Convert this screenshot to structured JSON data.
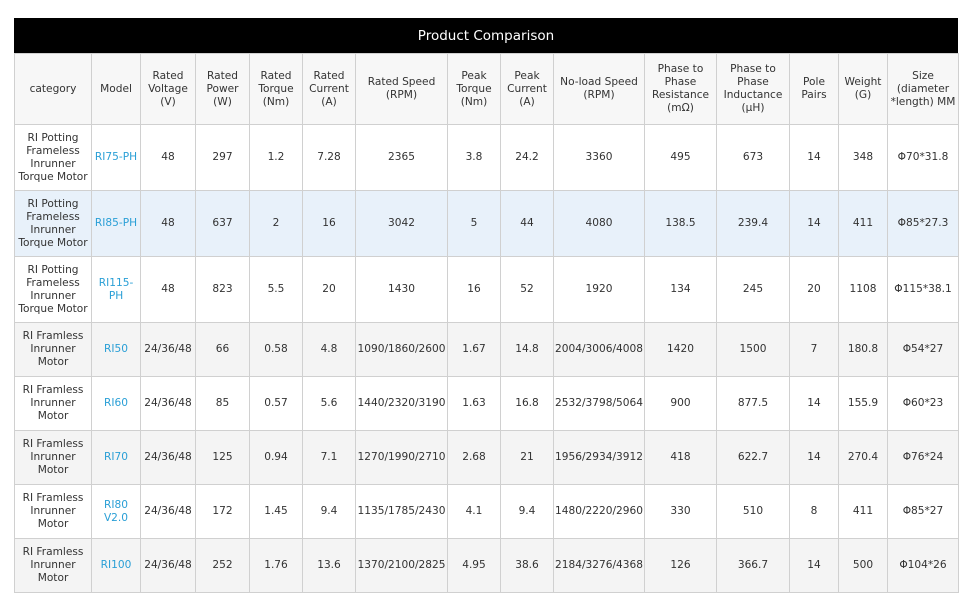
{
  "title": "Product Comparison",
  "colors": {
    "header_bar": "#000000",
    "link": "#2a9fd6",
    "highlight_row": "#e8f1fa",
    "alt_row": "#f4f4f4"
  },
  "columns": [
    "category",
    "Model",
    "Rated Voltage (V)",
    "Rated Power (W)",
    "Rated Torque (Nm)",
    "Rated Current (A)",
    "Rated Speed (RPM)",
    "Peak Torque (Nm)",
    "Peak Current (A)",
    "No-load Speed (RPM)",
    "Phase to Phase Resistance (mΩ)",
    "Phase to Phase Inductance (μH)",
    "Pole Pairs",
    "Weight (G)",
    "Size (diameter *length) MM"
  ],
  "rows": [
    {
      "bg": "white",
      "height": "r1",
      "cells": [
        "RI Potting Frameless Inrunner Torque Motor",
        "RI75-PH",
        "48",
        "297",
        "1.2",
        "7.28",
        "2365",
        "3.8",
        "24.2",
        "3360",
        "495",
        "673",
        "14",
        "348",
        "Φ70*31.8"
      ]
    },
    {
      "bg": "blue",
      "height": "r1",
      "cells": [
        "RI Potting Frameless Inrunner Torque Motor",
        "RI85-PH",
        "48",
        "637",
        "2",
        "16",
        "3042",
        "5",
        "44",
        "4080",
        "138.5",
        "239.4",
        "14",
        "411",
        "Φ85*27.3"
      ]
    },
    {
      "bg": "white",
      "height": "r1",
      "cells": [
        "RI Potting Frameless Inrunner Torque Motor",
        "RI115-PH",
        "48",
        "823",
        "5.5",
        "20",
        "1430",
        "16",
        "52",
        "1920",
        "134",
        "245",
        "20",
        "1108",
        "Φ115*38.1"
      ]
    },
    {
      "bg": "grey",
      "height": "r2",
      "cells": [
        "RI Framless Inrunner Motor",
        "RI50",
        "24/36/48",
        "66",
        "0.58",
        "4.8",
        "1090/1860/2600",
        "1.67",
        "14.8",
        "2004/3006/4008",
        "1420",
        "1500",
        "7",
        "180.8",
        "Φ54*27"
      ]
    },
    {
      "bg": "white",
      "height": "r2",
      "cells": [
        "RI Framless Inrunner Motor",
        "RI60",
        "24/36/48",
        "85",
        "0.57",
        "5.6",
        "1440/2320/3190",
        "1.63",
        "16.8",
        "2532/3798/5064",
        "900",
        "877.5",
        "14",
        "155.9",
        "Φ60*23"
      ]
    },
    {
      "bg": "grey",
      "height": "r2",
      "cells": [
        "RI Framless Inrunner Motor",
        "RI70",
        "24/36/48",
        "125",
        "0.94",
        "7.1",
        "1270/1990/2710",
        "2.68",
        "21",
        "1956/2934/3912",
        "418",
        "622.7",
        "14",
        "270.4",
        "Φ76*24"
      ]
    },
    {
      "bg": "white",
      "height": "r2",
      "cells": [
        "RI Framless Inrunner Motor",
        "RI80 V2.0",
        "24/36/48",
        "172",
        "1.45",
        "9.4",
        "1135/1785/2430",
        "4.1",
        "9.4",
        "1480/2220/2960",
        "330",
        "510",
        "8",
        "411",
        "Φ85*27"
      ]
    },
    {
      "bg": "grey",
      "height": "r2",
      "cells": [
        "RI Framless Inrunner Motor",
        "RI100",
        "24/36/48",
        "252",
        "1.76",
        "13.6",
        "1370/2100/2825",
        "4.95",
        "38.6",
        "2184/3276/4368",
        "126",
        "366.7",
        "14",
        "500",
        "Φ104*26"
      ]
    }
  ]
}
